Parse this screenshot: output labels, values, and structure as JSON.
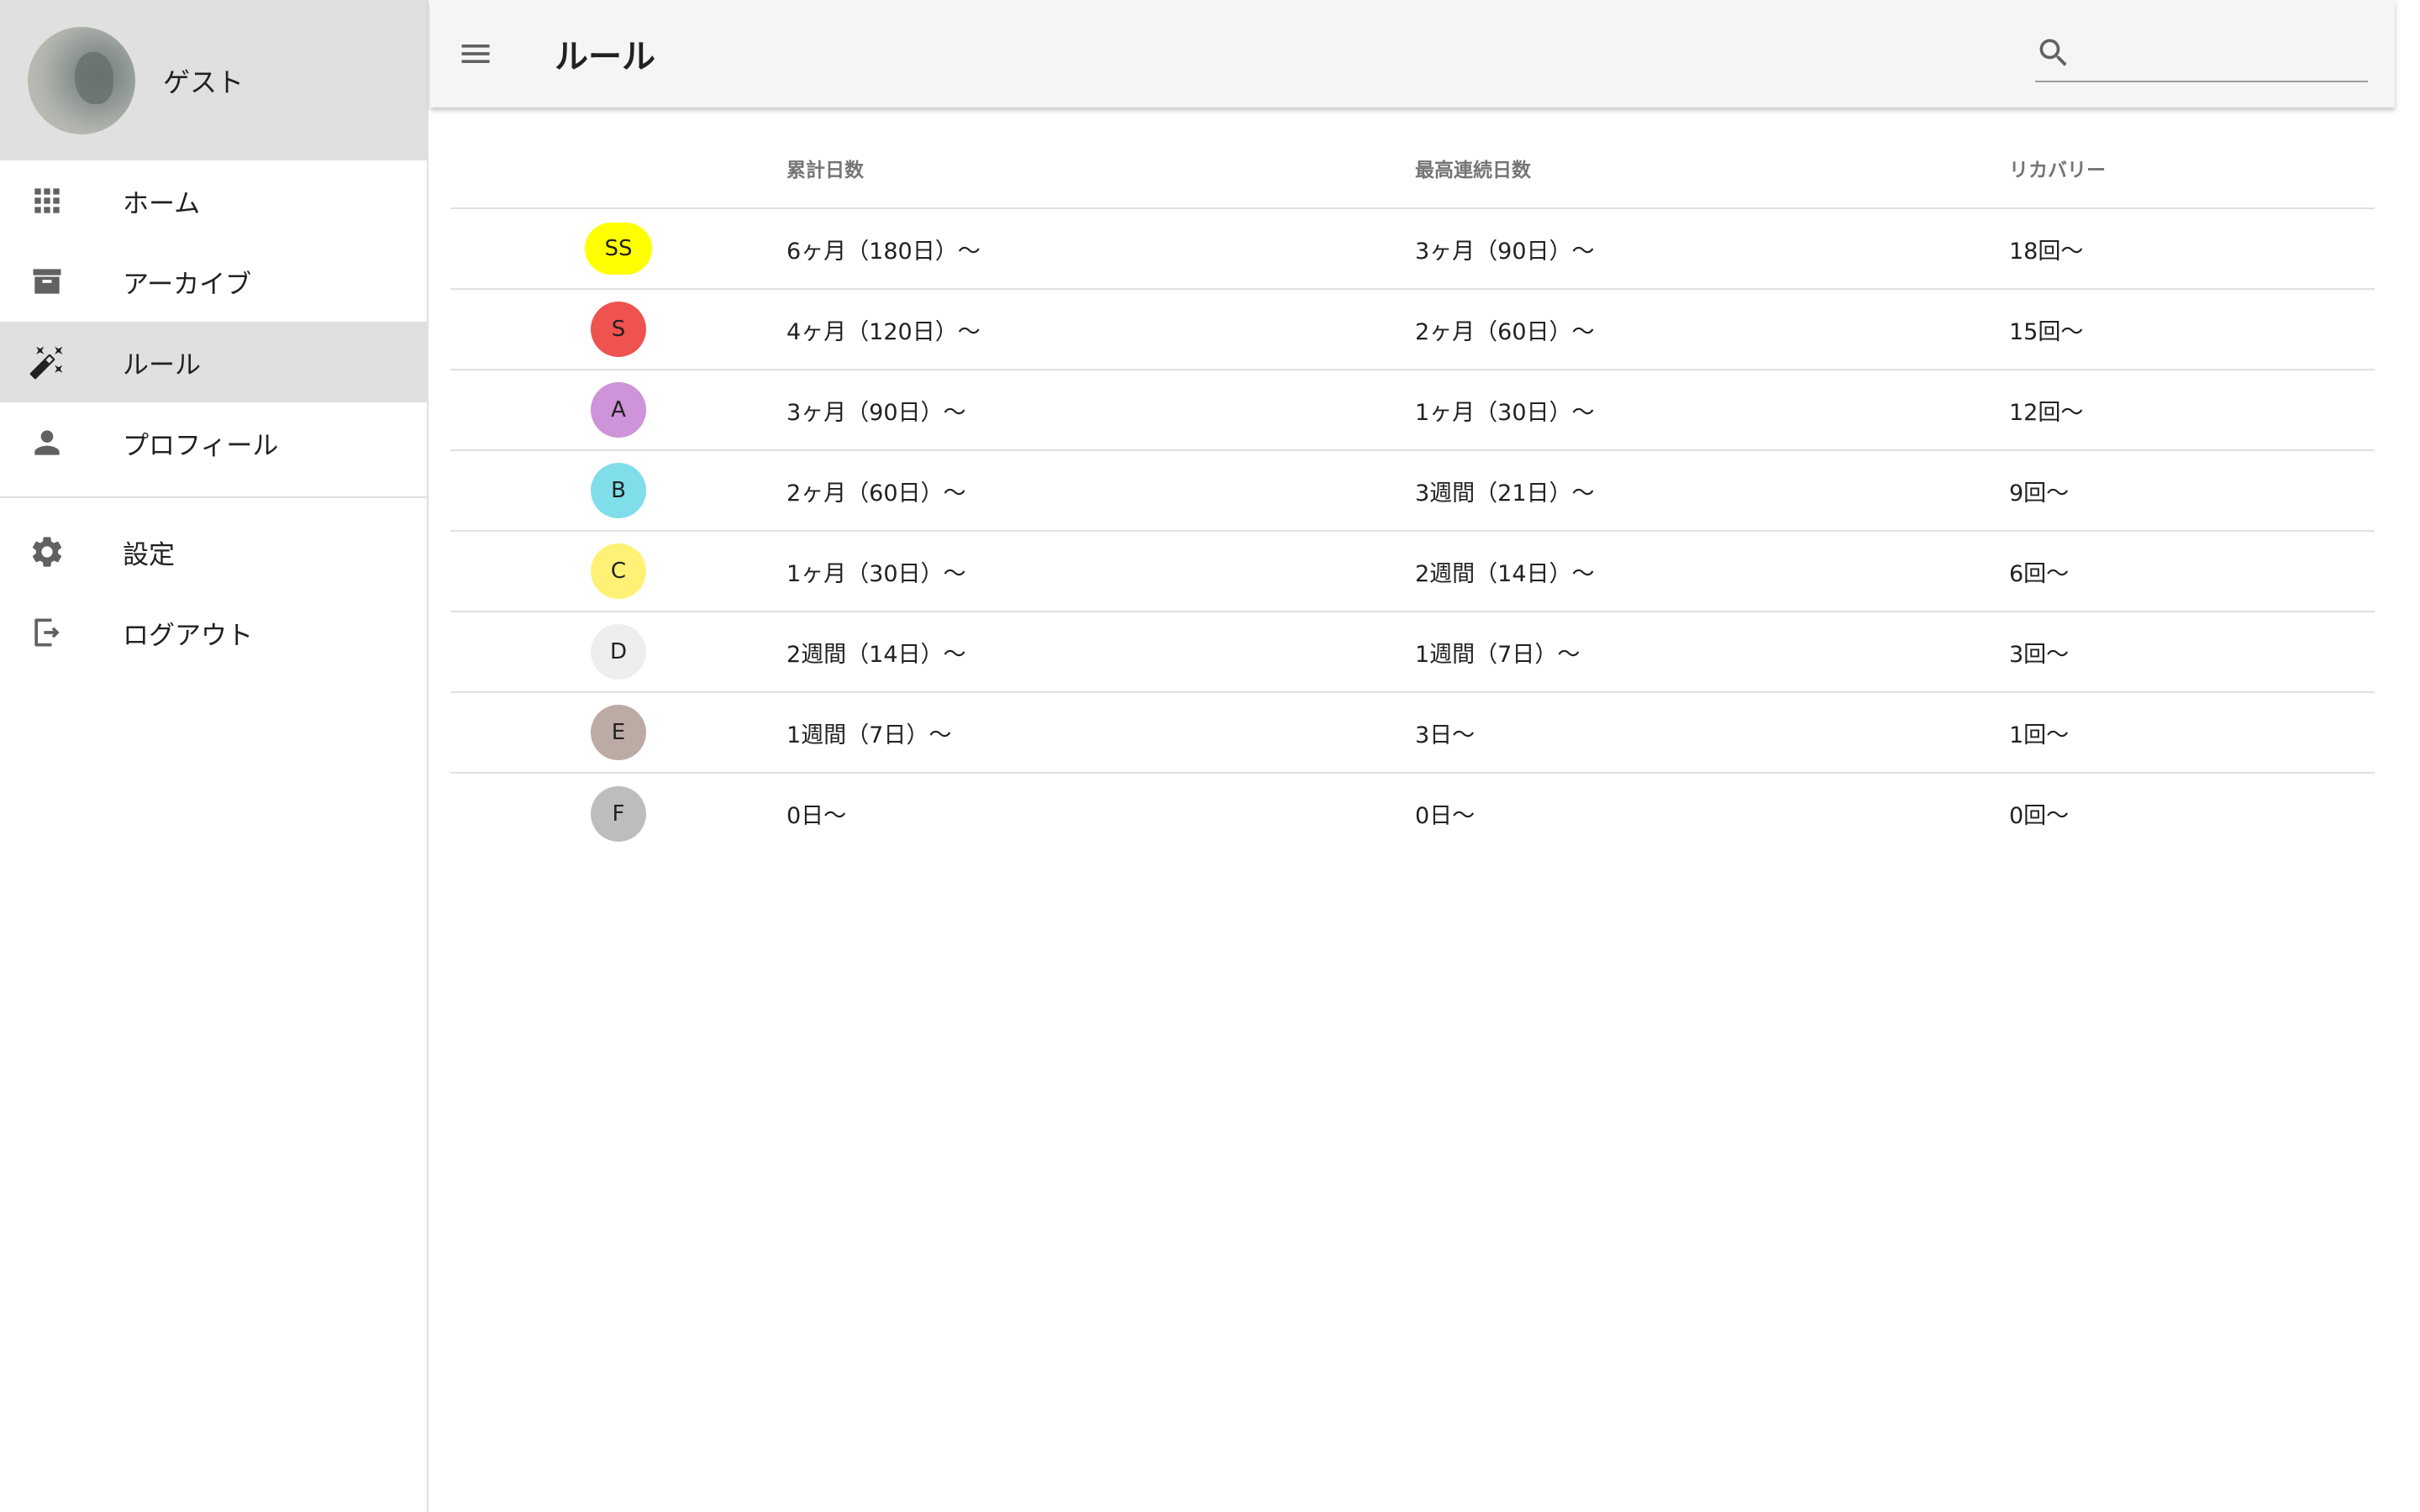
{
  "user": {
    "name": "ゲスト"
  },
  "sidebar": {
    "items": [
      {
        "label": "ホーム",
        "icon": "apps-grid-icon",
        "active": false
      },
      {
        "label": "アーカイブ",
        "icon": "archive-icon",
        "active": false
      },
      {
        "label": "ルール",
        "icon": "wand-icon",
        "active": true
      },
      {
        "label": "プロフィール",
        "icon": "person-icon",
        "active": false
      }
    ],
    "secondary": [
      {
        "label": "設定",
        "icon": "gear-icon"
      },
      {
        "label": "ログアウト",
        "icon": "logout-icon"
      }
    ]
  },
  "header": {
    "title": "ルール",
    "search": {
      "value": "",
      "placeholder": ""
    }
  },
  "table": {
    "headers": [
      "",
      "累計日数",
      "最高連続日数",
      "リカバリー"
    ],
    "rows": [
      {
        "rank": "SS",
        "color": "#ffff00",
        "cumulative": "6ヶ月（180日）〜",
        "max_streak": "3ヶ月（90日）〜",
        "recovery": "18回〜"
      },
      {
        "rank": "S",
        "color": "#ef5350",
        "cumulative": "4ヶ月（120日）〜",
        "max_streak": "2ヶ月（60日）〜",
        "recovery": "15回〜"
      },
      {
        "rank": "A",
        "color": "#ce93d8",
        "cumulative": "3ヶ月（90日）〜",
        "max_streak": "1ヶ月（30日）〜",
        "recovery": "12回〜"
      },
      {
        "rank": "B",
        "color": "#80deea",
        "cumulative": "2ヶ月（60日）〜",
        "max_streak": "3週間（21日）〜",
        "recovery": "9回〜"
      },
      {
        "rank": "C",
        "color": "#fff176",
        "cumulative": "1ヶ月（30日）〜",
        "max_streak": "2週間（14日）〜",
        "recovery": "6回〜"
      },
      {
        "rank": "D",
        "color": "#eeeeee",
        "cumulative": "2週間（14日）〜",
        "max_streak": "1週間（7日）〜",
        "recovery": "3回〜"
      },
      {
        "rank": "E",
        "color": "#bcaaa4",
        "cumulative": "1週間（7日）〜",
        "max_streak": "3日〜",
        "recovery": "1回〜"
      },
      {
        "rank": "F",
        "color": "#bdbdbd",
        "cumulative": "0日〜",
        "max_streak": "0日〜",
        "recovery": "0回〜"
      }
    ]
  }
}
